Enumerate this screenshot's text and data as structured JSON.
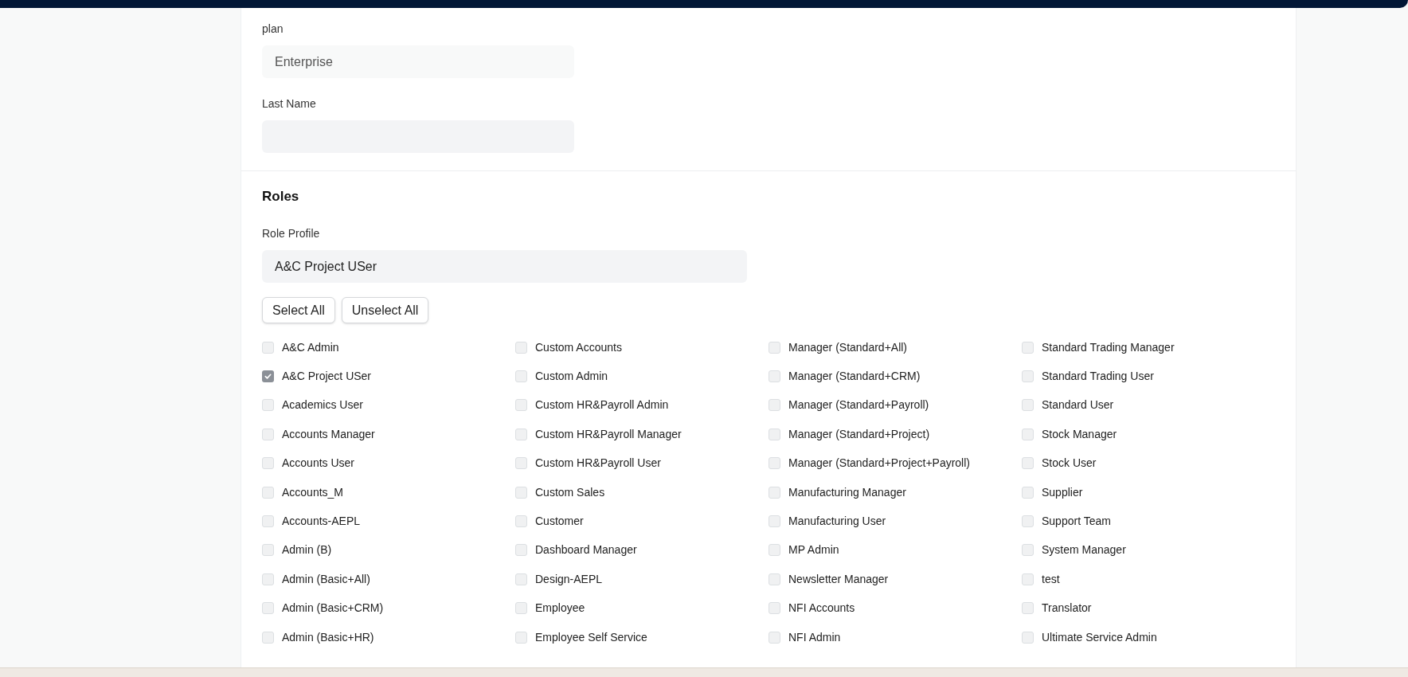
{
  "fields": [
    {
      "label": "plan",
      "value": "Enterprise",
      "kind": "readonly"
    },
    {
      "label": "Last Name",
      "kind": "input"
    }
  ],
  "roles": {
    "title": "Roles",
    "profile_label": "Role Profile",
    "profile_value": "A&C Project USer",
    "buttons": [
      "Select All",
      "Unselect All"
    ],
    "columns": [
      [
        {
          "label": "A&C Admin",
          "checked": false
        },
        {
          "label": "A&C Project USer",
          "checked": true
        },
        {
          "label": "Academics User",
          "checked": false
        },
        {
          "label": "Accounts Manager",
          "checked": false
        },
        {
          "label": "Accounts User",
          "checked": false
        },
        {
          "label": "Accounts_M",
          "checked": false
        },
        {
          "label": "Accounts-AEPL",
          "checked": false
        },
        {
          "label": "Admin (B)",
          "checked": false
        },
        {
          "label": "Admin (Basic+All)",
          "checked": false
        },
        {
          "label": "Admin (Basic+CRM)",
          "checked": false
        },
        {
          "label": "Admin (Basic+HR)",
          "checked": false
        }
      ],
      [
        {
          "label": "Custom Accounts",
          "checked": false
        },
        {
          "label": "Custom Admin",
          "checked": false
        },
        {
          "label": "Custom HR&Payroll Admin",
          "checked": false
        },
        {
          "label": "Custom HR&Payroll Manager",
          "checked": false
        },
        {
          "label": "Custom HR&Payroll User",
          "checked": false
        },
        {
          "label": "Custom Sales",
          "checked": false
        },
        {
          "label": "Customer",
          "checked": false
        },
        {
          "label": "Dashboard Manager",
          "checked": false
        },
        {
          "label": "Design-AEPL",
          "checked": false
        },
        {
          "label": "Employee",
          "checked": false
        },
        {
          "label": "Employee Self Service",
          "checked": false
        }
      ],
      [
        {
          "label": "Manager (Standard+All)",
          "checked": false
        },
        {
          "label": "Manager (Standard+CRM)",
          "checked": false
        },
        {
          "label": "Manager (Standard+Payroll)",
          "checked": false
        },
        {
          "label": "Manager (Standard+Project)",
          "checked": false
        },
        {
          "label": "Manager (Standard+Project+Payroll)",
          "checked": false
        },
        {
          "label": "Manufacturing Manager",
          "checked": false
        },
        {
          "label": "Manufacturing User",
          "checked": false
        },
        {
          "label": "MP Admin",
          "checked": false
        },
        {
          "label": "Newsletter Manager",
          "checked": false
        },
        {
          "label": "NFI Accounts",
          "checked": false
        },
        {
          "label": "NFI Admin",
          "checked": false
        }
      ],
      [
        {
          "label": "Standard Trading Manager",
          "checked": false
        },
        {
          "label": "Standard Trading User",
          "checked": false
        },
        {
          "label": "Standard User",
          "checked": false
        },
        {
          "label": "Stock Manager",
          "checked": false
        },
        {
          "label": "Stock User",
          "checked": false
        },
        {
          "label": "Supplier",
          "checked": false
        },
        {
          "label": "Support Team",
          "checked": false
        },
        {
          "label": "System Manager",
          "checked": false
        },
        {
          "label": "test",
          "checked": false
        },
        {
          "label": "Translator",
          "checked": false
        },
        {
          "label": "Ultimate Service Admin",
          "checked": false
        }
      ]
    ]
  }
}
